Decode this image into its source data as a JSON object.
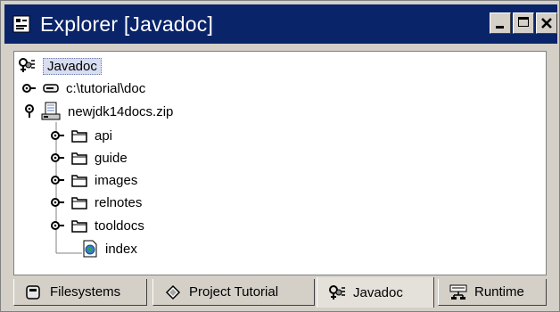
{
  "window": {
    "title": "Explorer [Javadoc]",
    "minimize_label": "_",
    "maximize_label": "□",
    "close_label": "×"
  },
  "tree": {
    "root": {
      "label": "Javadoc",
      "icon": "javadoc-icon",
      "selected": true
    },
    "nodes": [
      {
        "label": "c:\\tutorial\\doc",
        "icon": "drive-icon",
        "expanded": false
      },
      {
        "label": "newjdk14docs.zip",
        "icon": "zip-archive-icon",
        "expanded": true,
        "children": [
          {
            "label": "api",
            "icon": "folder-icon"
          },
          {
            "label": "guide",
            "icon": "folder-icon"
          },
          {
            "label": "images",
            "icon": "folder-icon"
          },
          {
            "label": "relnotes",
            "icon": "folder-icon"
          },
          {
            "label": "tooldocs",
            "icon": "folder-icon"
          },
          {
            "label": "index",
            "icon": "html-document-icon"
          }
        ]
      }
    ]
  },
  "tabs": [
    {
      "label": "Filesystems",
      "icon": "filesystems-icon",
      "active": false
    },
    {
      "label": "Project Tutorial",
      "icon": "project-icon",
      "active": false
    },
    {
      "label": "Javadoc",
      "icon": "javadoc-icon",
      "active": true
    },
    {
      "label": "Runtime",
      "icon": "runtime-icon",
      "active": false
    }
  ],
  "colors": {
    "titlebar": "#0a246a",
    "background": "#d4d0c8",
    "selection": "#d8ddf0"
  }
}
